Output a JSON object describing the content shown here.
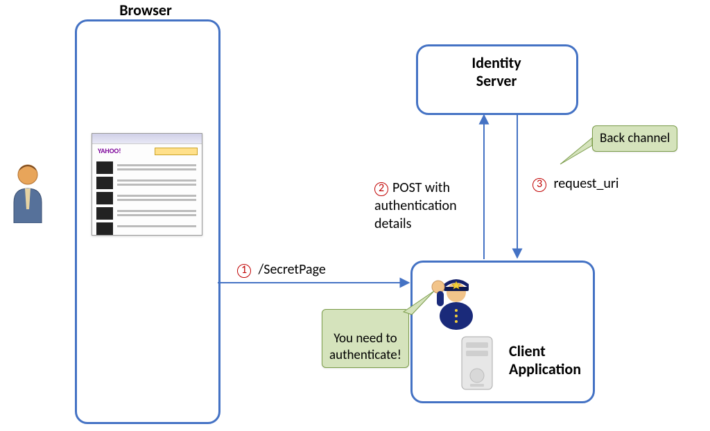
{
  "titles": {
    "browser": "Browser",
    "identity": "Identity\nServer",
    "client": "Client\nApplication"
  },
  "steps": {
    "s1": {
      "num": "1",
      "text": "/SecretPage"
    },
    "s2": {
      "num": "2",
      "text": "POST with\nauthentication\ndetails"
    },
    "s3": {
      "num": "3",
      "text": "request_uri"
    }
  },
  "callouts": {
    "back_channel": "Back channel",
    "need_auth": "You need to\nauthenticate!"
  },
  "icons": {
    "user": "user-icon",
    "webpage": "webpage-thumbnail",
    "police": "police-icon",
    "server": "server-icon"
  },
  "colors": {
    "box_border": "#4472c4",
    "arrow": "#4472c4",
    "step_num": "#c00000",
    "callout_fill": "#d5e3bc",
    "callout_border": "#7a9b49"
  }
}
